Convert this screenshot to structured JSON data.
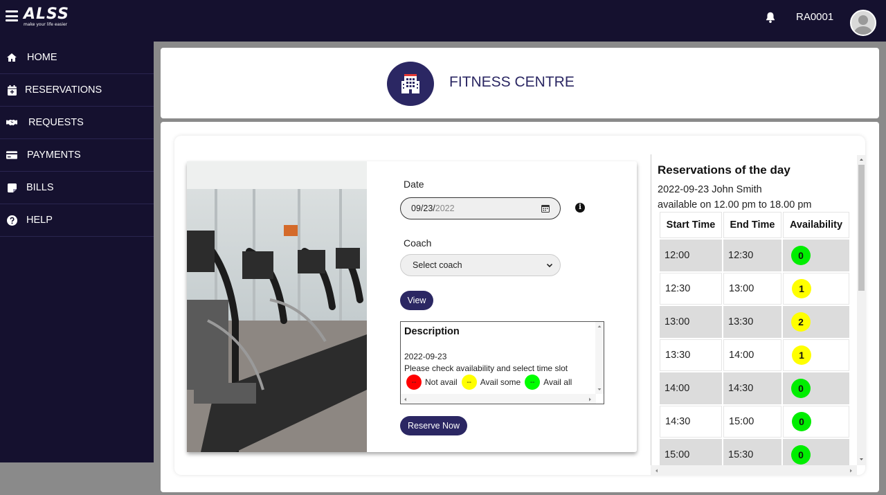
{
  "topbar": {
    "logo_text": "ALSS",
    "logo_tagline": "make your life easier",
    "user_id": "RA0001"
  },
  "sidebar": {
    "items": [
      {
        "label": "HOME",
        "icon": "home-icon"
      },
      {
        "label": "RESERVATIONS",
        "icon": "calendar-plus-icon"
      },
      {
        "label": "REQUESTS",
        "icon": "handshake-icon"
      },
      {
        "label": "PAYMENTS",
        "icon": "credit-card-icon"
      },
      {
        "label": "BILLS",
        "icon": "sticky-note-icon"
      },
      {
        "label": "HELP",
        "icon": "question-circle-icon"
      }
    ]
  },
  "header": {
    "title": "FITNESS CENTRE",
    "icon": "building-icon"
  },
  "form": {
    "date_label": "Date",
    "date_month": "09",
    "date_day": "23",
    "date_year": "2022",
    "coach_label": "Coach",
    "coach_selected": "Select coach",
    "view_label": "View",
    "reserve_label": "Reserve Now"
  },
  "description": {
    "title": "Description",
    "date": "2022-09-23",
    "message": "Please check availability and select time slot",
    "legend": [
      {
        "label": "Not avail",
        "dot_text": "--",
        "color": "#ff0000"
      },
      {
        "label": "Avail some",
        "dot_text": "--",
        "color": "#ffff00"
      },
      {
        "label": "Avail all",
        "dot_text": "--",
        "color": "#00ff00"
      }
    ]
  },
  "reservations": {
    "title": "Reservations of the day",
    "line1": "2022-09-23 John Smith",
    "line2": "available on 12.00 pm to 18.00 pm",
    "headers": [
      "Start Time",
      "End Time",
      "Availability"
    ],
    "rows": [
      {
        "start": "12:00",
        "end": "12:30",
        "avail": "0",
        "color": "#00ee00"
      },
      {
        "start": "12:30",
        "end": "13:00",
        "avail": "1",
        "color": "#ffff00"
      },
      {
        "start": "13:00",
        "end": "13:30",
        "avail": "2",
        "color": "#ffff00"
      },
      {
        "start": "13:30",
        "end": "14:00",
        "avail": "1",
        "color": "#ffff00"
      },
      {
        "start": "14:00",
        "end": "14:30",
        "avail": "0",
        "color": "#00ee00"
      },
      {
        "start": "14:30",
        "end": "15:00",
        "avail": "0",
        "color": "#00ee00"
      },
      {
        "start": "15:00",
        "end": "15:30",
        "avail": "0",
        "color": "#00ee00"
      }
    ]
  },
  "colors": {
    "navy": "#15112f",
    "accent": "#2b2763"
  }
}
